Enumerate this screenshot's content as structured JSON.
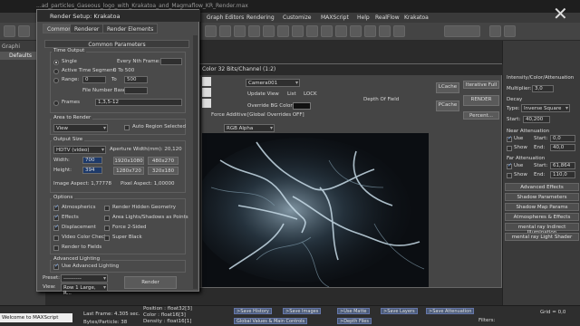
{
  "app": {
    "title": "...ad_particles_Gaseous_logo_with_Krakatoa_and_Magmaflow_KR_Render.max",
    "menu": [
      "Graph Editors",
      "Rendering",
      "Customize",
      "MAXScript",
      "Help",
      "RealFlow",
      "Krakatoa"
    ],
    "left_panel": {
      "tab": "Defaults",
      "graph_label": "Graphi"
    }
  },
  "render_setup": {
    "title": "Render Setup: Krakatoa",
    "tabs": [
      "Common",
      "Renderer",
      "Render Elements"
    ],
    "rollout_title": "Common Parameters",
    "time_output": {
      "label": "Time Output",
      "single": "Single",
      "every_nth_frame": "Every Nth Frame:",
      "active_segment_label": "Active Time Segment:",
      "active_segment_value": "0 To 500",
      "range_label": "Range:",
      "range_start": "0",
      "range_to": "To",
      "range_end": "500",
      "file_number_base": "File Number Base:",
      "frames_label": "Frames",
      "frames_value": "1,3,5-12"
    },
    "area_to_render": {
      "label": "Area to Render",
      "value": "View",
      "auto_region": "Auto Region Selected"
    },
    "output_size": {
      "label": "Output Size",
      "preset": "HDTV (video)",
      "aperture": "Aperture Width(mm): 20,120",
      "width_label": "Width:",
      "width_value": "700",
      "height_label": "Height:",
      "height_value": "394",
      "presets": [
        "1280x720",
        "1920x1080",
        "480x270",
        "1280x720",
        "320x180"
      ],
      "image_aspect": "Image Aspect: 1,77778",
      "pixel_aspect": "Pixel Aspect: 1,00000"
    },
    "options": {
      "label": "Options",
      "left": [
        "Atmospherics",
        "Effects",
        "Displacement",
        "Video Color Check",
        "Render to Fields"
      ],
      "right": [
        "Render Hidden Geometry",
        "Area Lights/Shadows as Points",
        "Force 2-Sided",
        "Super Black"
      ]
    },
    "advanced_lighting": {
      "label": "Advanced Lighting",
      "use": "Use Advanced Lighting"
    },
    "bottom": {
      "preset_label": "Preset:",
      "preset_value": "----------",
      "view_label": "View:",
      "view_value": "Row 1 Large, R...",
      "render_button": "Render"
    }
  },
  "frame_buffer": {
    "title": "Color 32 Bits/Channel (1:2)",
    "camera": "Camera001",
    "update_view": "Update View",
    "list": "List",
    "lock": "LOCK",
    "override_bg": "Override BG Color",
    "force_additive": "Force Additive",
    "global_overrides": "[Global Overrides OFF]",
    "channel": "RGB Alpha",
    "depth_of_field": "Depth Of Field",
    "lcache": "LCache",
    "pcache": "PCache",
    "iterative": "Iterative Full",
    "render": "RENDER",
    "percent": "Percent..."
  },
  "right_panel": {
    "title": "Intensity/Color/Attenuation",
    "multiplier_label": "Multiplier:",
    "multiplier_value": "3,0",
    "decay": "Decay",
    "type_label": "Type:",
    "type_value": "Inverse Square",
    "start_label": "Start:",
    "start_value": "40,200",
    "near": "Near Attenuation",
    "use": "Use",
    "show": "Show",
    "near_start": "Start:",
    "near_start_value": "0,0",
    "near_end": "End:",
    "near_end_value": "40,0",
    "far": "Far Attenuation",
    "far_start_value": "61,864",
    "far_end_value": "110,0",
    "buttons": [
      "Advanced Effects",
      "Shadow Parameters",
      "Shadow Map Params",
      "Atmospheres & Effects",
      "mental ray Indirect Illumination",
      "mental ray Light Shader"
    ]
  },
  "status": {
    "maxscript": "Welcome to MAXScript",
    "frame_info": "Last Frame: 4.305 sec.",
    "bytes": "Bytes/Particle: 38",
    "position": "Position : float32[3]",
    "color": "Color : float16[3]",
    "density": "Density : float16[1]",
    "buttons_top": [
      ">Save History",
      ">Save Images",
      ">Use Matte",
      ">Save Layers",
      ">Save Attenuation"
    ],
    "buttons_bottom": [
      "Global Values & Main Controls",
      ">Depth Files"
    ],
    "filters": "Filters:",
    "grid": "Grid = 0,0"
  }
}
